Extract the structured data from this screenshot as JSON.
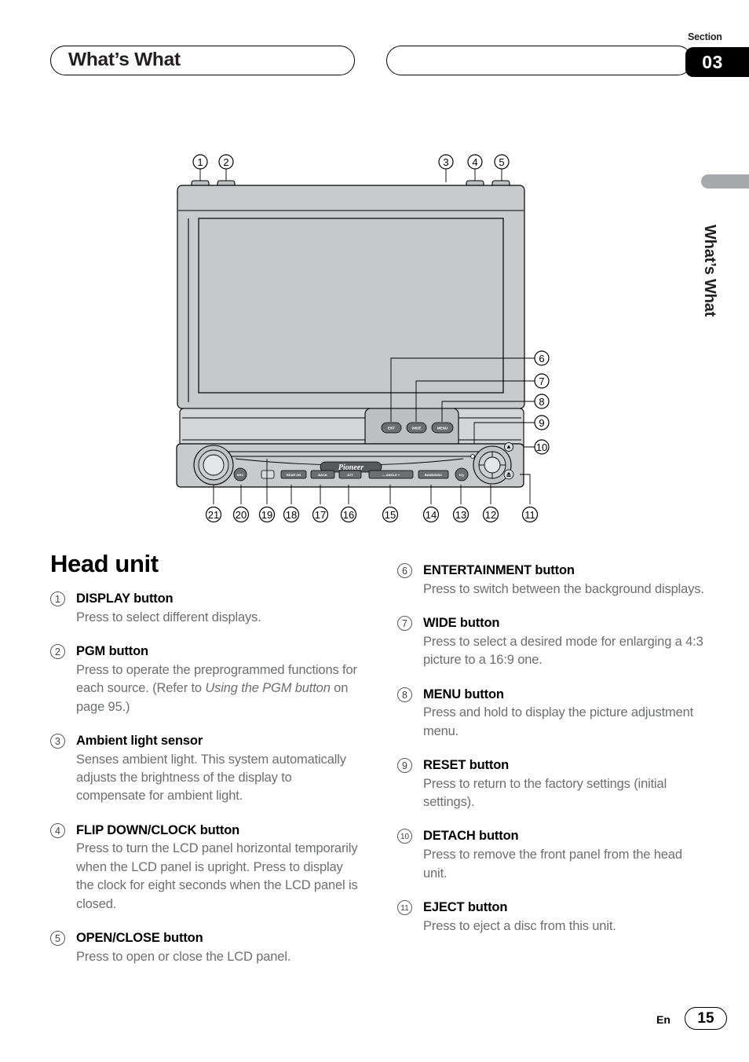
{
  "header": {
    "chapter_title": "What’s What",
    "section_word": "Section",
    "section_number": "03"
  },
  "side_tab": {
    "label": "What’s What"
  },
  "diagram": {
    "brand_logo": "Pioneer",
    "panel_buttons": [
      {
        "label": "ENT"
      },
      {
        "label": "WIDE"
      },
      {
        "label": "MENU"
      }
    ],
    "face_buttons": [
      {
        "label": "REAR ON"
      },
      {
        "label": "BACK"
      },
      {
        "label": "ATT"
      },
      {
        "label": "—  ANGLE  +"
      },
      {
        "label": "BAND/DISC"
      }
    ],
    "round_buttons": [
      {
        "label": "SRC"
      },
      {
        "label": "EQ"
      }
    ],
    "callouts_top": [
      "1",
      "2",
      "3",
      "4",
      "5"
    ],
    "callouts_right": [
      "6",
      "7",
      "8",
      "9",
      "10"
    ],
    "callouts_bottom": [
      "21",
      "20",
      "19",
      "18",
      "17",
      "16",
      "15",
      "14",
      "13",
      "12",
      "11"
    ]
  },
  "main": {
    "title": "Head unit",
    "left_entries": [
      {
        "num": "1",
        "title": "DISPLAY button",
        "desc": "Press to select different displays."
      },
      {
        "num": "2",
        "title": "PGM button",
        "desc_pre": "Press to operate the preprogrammed functions for each source. (Refer to ",
        "desc_italic": "Using the PGM button",
        "desc_post": " on page 95.)"
      },
      {
        "num": "3",
        "title": "Ambient light sensor",
        "desc": "Senses ambient light. This system automatically adjusts the brightness of the display to compensate for ambient light."
      },
      {
        "num": "4",
        "title": "FLIP DOWN/CLOCK button",
        "desc": "Press to turn the LCD panel horizontal temporarily when the LCD panel is upright. Press to display the clock for eight seconds when the LCD panel is closed."
      },
      {
        "num": "5",
        "title": "OPEN/CLOSE button",
        "desc": "Press to open or close the LCD panel."
      }
    ],
    "right_entries": [
      {
        "num": "6",
        "title": "ENTERTAINMENT button",
        "desc": "Press to switch between the background displays."
      },
      {
        "num": "7",
        "title": "WIDE button",
        "desc": "Press to select a desired mode for enlarging a 4:3 picture to a 16:9 one."
      },
      {
        "num": "8",
        "title": "MENU button",
        "desc": "Press and hold to display the picture adjustment menu."
      },
      {
        "num": "9",
        "title": "RESET button",
        "desc": "Press to return to the factory settings (initial settings)."
      },
      {
        "num": "10",
        "title": "DETACH button",
        "desc": "Press to remove the front panel from the head unit."
      },
      {
        "num": "11",
        "title": "EJECT button",
        "desc": "Press to eject a disc from this unit."
      }
    ]
  },
  "footer": {
    "language": "En",
    "page_number": "15"
  }
}
